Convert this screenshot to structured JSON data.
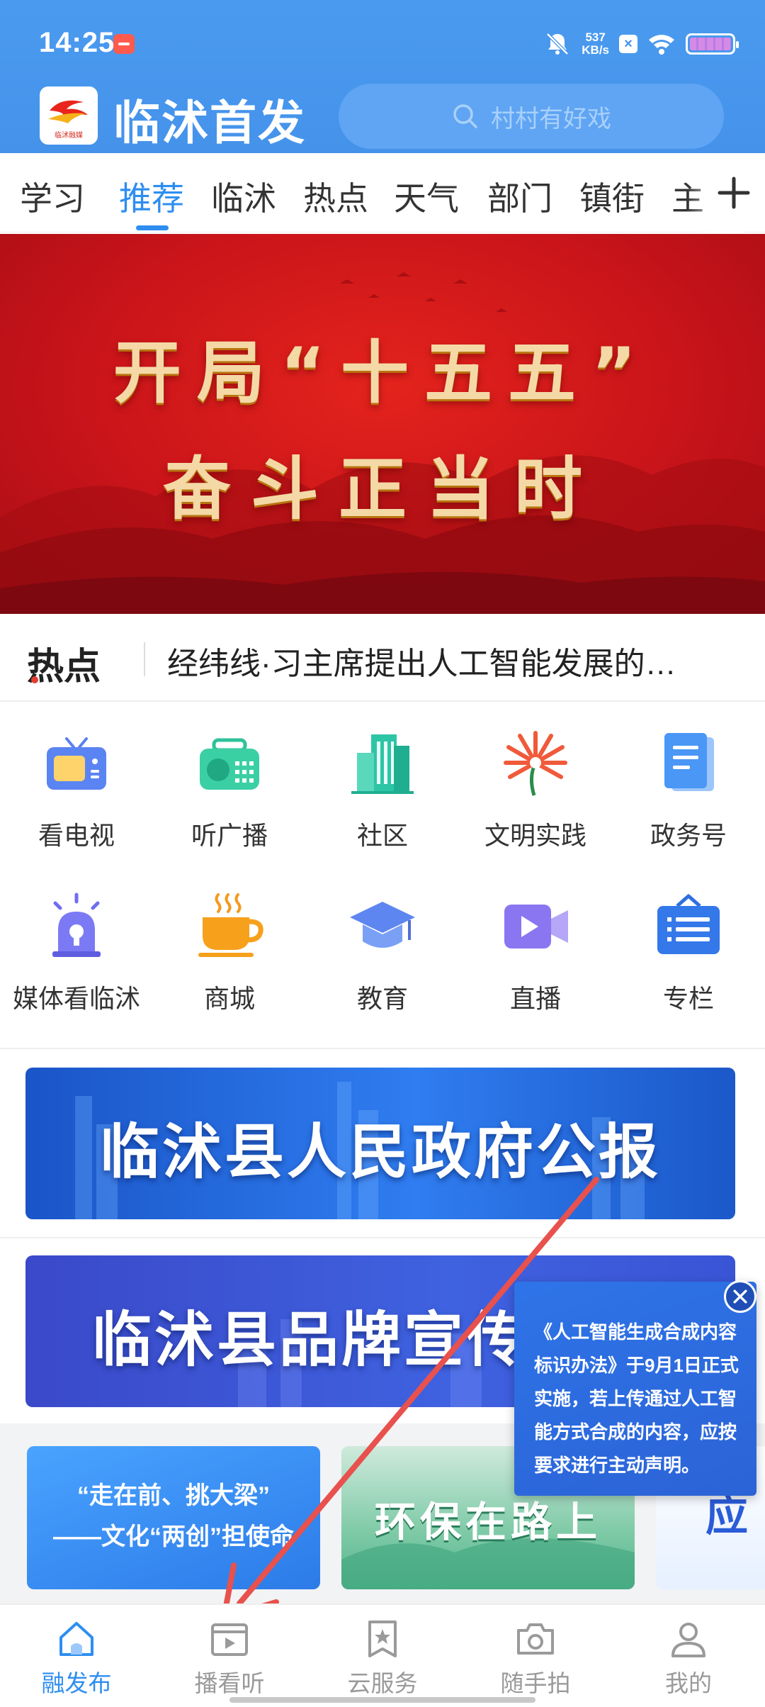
{
  "status_bar": {
    "time": "14:25",
    "net_speed_value": "537",
    "net_speed_unit": "KB/s"
  },
  "header": {
    "app_name": "临沭首发",
    "logo_caption": "临沭融媒",
    "search_placeholder": "村村有好戏"
  },
  "tabs": [
    {
      "label": "学习",
      "active": false
    },
    {
      "label": "推荐",
      "active": true
    },
    {
      "label": "临沭",
      "active": false
    },
    {
      "label": "热点",
      "active": false
    },
    {
      "label": "天气",
      "active": false
    },
    {
      "label": "部门",
      "active": false
    },
    {
      "label": "镇街",
      "active": false
    },
    {
      "label": "主",
      "active": false
    }
  ],
  "banner": {
    "line1": "开局“十五五”",
    "line2": "奋斗正当时"
  },
  "hot_news": {
    "label": "热点",
    "headline": "经纬线·习主席提出人工智能发展的…"
  },
  "services": [
    {
      "label": "看电视",
      "icon": "tv-icon"
    },
    {
      "label": "听广播",
      "icon": "radio-icon"
    },
    {
      "label": "社区",
      "icon": "building-icon"
    },
    {
      "label": "文明实践",
      "icon": "flower-icon"
    },
    {
      "label": "政务号",
      "icon": "document-icon"
    },
    {
      "label": "媒体看临沭",
      "icon": "alarm-light-icon"
    },
    {
      "label": "商城",
      "icon": "coffee-cup-icon"
    },
    {
      "label": "教育",
      "icon": "graduation-cap-icon"
    },
    {
      "label": "直播",
      "icon": "video-camera-icon"
    },
    {
      "label": "专栏",
      "icon": "column-board-icon"
    }
  ],
  "promos": [
    {
      "title": "临沭县人民政府公报"
    },
    {
      "title": "临沭县品牌宣传战"
    }
  ],
  "cards": [
    {
      "line1": "“走在前、挑大梁”",
      "line2": "——文化“两创”担使命"
    },
    {
      "title": "环保在路上"
    },
    {
      "title": "应"
    }
  ],
  "notice": {
    "text": "《人工智能生成合成内容标识办法》于9月1日正式实施，若上传通过人工智能方式合成的内容，应按要求进行主动声明。"
  },
  "bottom_nav": [
    {
      "label": "融发布",
      "icon": "home-icon",
      "active": true
    },
    {
      "label": "播看听",
      "icon": "video-play-icon",
      "active": false
    },
    {
      "label": "云服务",
      "icon": "star-bookmark-icon",
      "active": false
    },
    {
      "label": "随手拍",
      "icon": "camera-icon",
      "active": false
    },
    {
      "label": "我的",
      "icon": "person-icon",
      "active": false
    }
  ],
  "colors": {
    "header_blue": "#4592ea",
    "accent_blue": "#2e8ef0",
    "banner_red": "#c9141a",
    "annotation_arrow": "#e8514d"
  }
}
